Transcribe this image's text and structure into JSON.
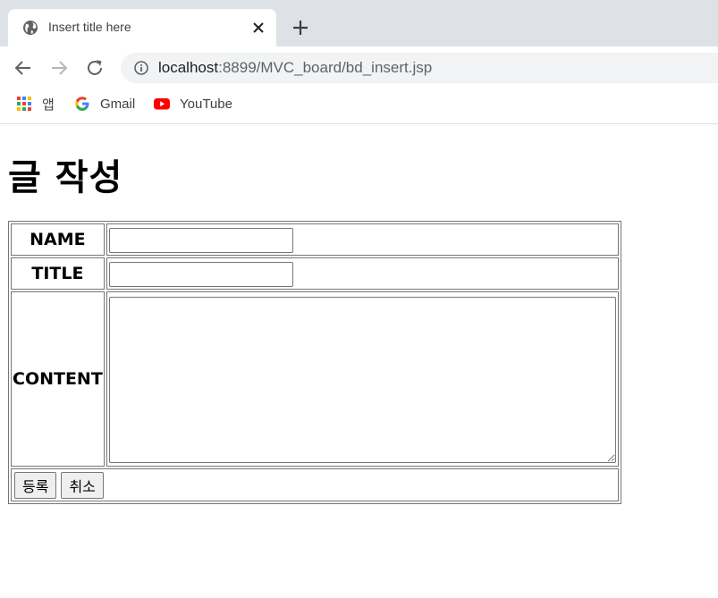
{
  "browser": {
    "tab": {
      "title": "Insert title here"
    },
    "url": {
      "host": "localhost",
      "path": ":8899/MVC_board/bd_insert.jsp"
    },
    "bookmarks": [
      {
        "label": "앱",
        "icon": "apps-grid-icon"
      },
      {
        "label": "Gmail",
        "icon": "google-icon"
      },
      {
        "label": "YouTube",
        "icon": "youtube-icon"
      }
    ]
  },
  "page": {
    "heading": "글 작성",
    "form": {
      "name_label": "NAME",
      "name_value": "",
      "title_label": "TITLE",
      "title_value": "",
      "content_label": "CONTENT",
      "content_value": "",
      "submit_label": "등록",
      "cancel_label": "취소"
    }
  },
  "colors": {
    "tabstrip": "#dee1e6",
    "omnibox": "#f1f3f4",
    "border": "#767676",
    "button": "#efefef"
  }
}
